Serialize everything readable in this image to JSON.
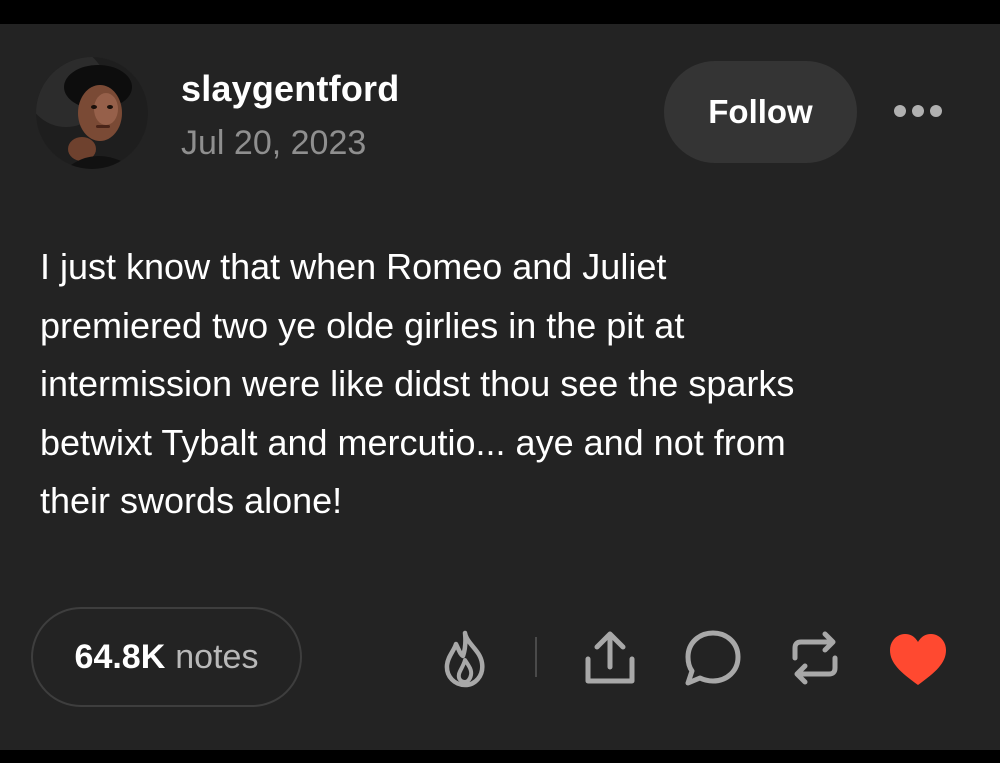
{
  "post": {
    "username": "slaygentford",
    "date": "Jul 20, 2023",
    "follow_label": "Follow",
    "body_lines": [
      "I just know that when Romeo and Juliet",
      "premiered two ye olde girlies in the pit at",
      "intermission were like didst thou see the sparks",
      "betwixt Tybalt and mercutio... aye and not from",
      "their swords alone!"
    ]
  },
  "footer": {
    "notes_count": "64.8K",
    "notes_label": "notes",
    "actions": [
      "blaze-icon",
      "share-icon",
      "reply-icon",
      "reblog-icon",
      "like-icon"
    ]
  },
  "colors": {
    "background": "#000000",
    "card": "#232323",
    "muted_text": "#8f8f8f",
    "like_red": "#ff4930",
    "icon_gray": "#a8a8a8"
  }
}
